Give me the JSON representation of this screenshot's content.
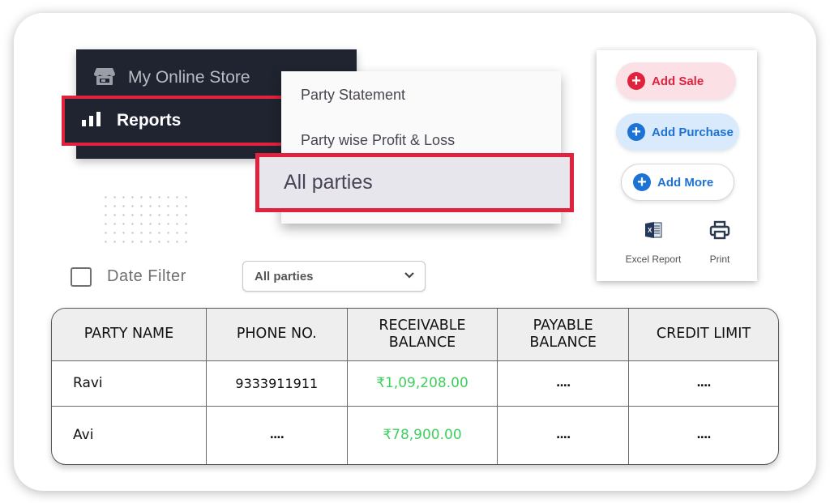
{
  "nav": {
    "items": [
      {
        "label": "My Online Store",
        "icon": "store-icon"
      },
      {
        "label": "Reports",
        "icon": "bar-chart-icon",
        "active": true
      }
    ]
  },
  "submenu": {
    "items": [
      {
        "label": "Party Statement"
      },
      {
        "label": "Party wise Profit & Loss"
      },
      {
        "label": "All parties",
        "active": true
      }
    ]
  },
  "filters": {
    "date_filter_label": "Date Filter",
    "date_filter_checked": false,
    "party_select_value": "All parties"
  },
  "actions": {
    "add_sale": "Add Sale",
    "add_purchase": "Add Purchase",
    "add_more": "Add More",
    "excel_report": "Excel Report",
    "print": "Print"
  },
  "table": {
    "headers": [
      "PARTY NAME",
      "PHONE NO.",
      "RECEIVABLE\nBALANCE",
      "PAYABLE\nBALANCE",
      "CREDIT LIMIT"
    ],
    "rows": [
      [
        "Ravi",
        "9333911911",
        "₹1,09,208.00",
        "....",
        "...."
      ],
      [
        "Avi",
        "....",
        "₹78,900.00",
        "....",
        "...."
      ]
    ]
  },
  "colors": {
    "highlight_border": "#e0223f",
    "nav_bg": "#1f2430",
    "receivable_text": "#3ecf5c",
    "primary_blue": "#1d72d6"
  }
}
